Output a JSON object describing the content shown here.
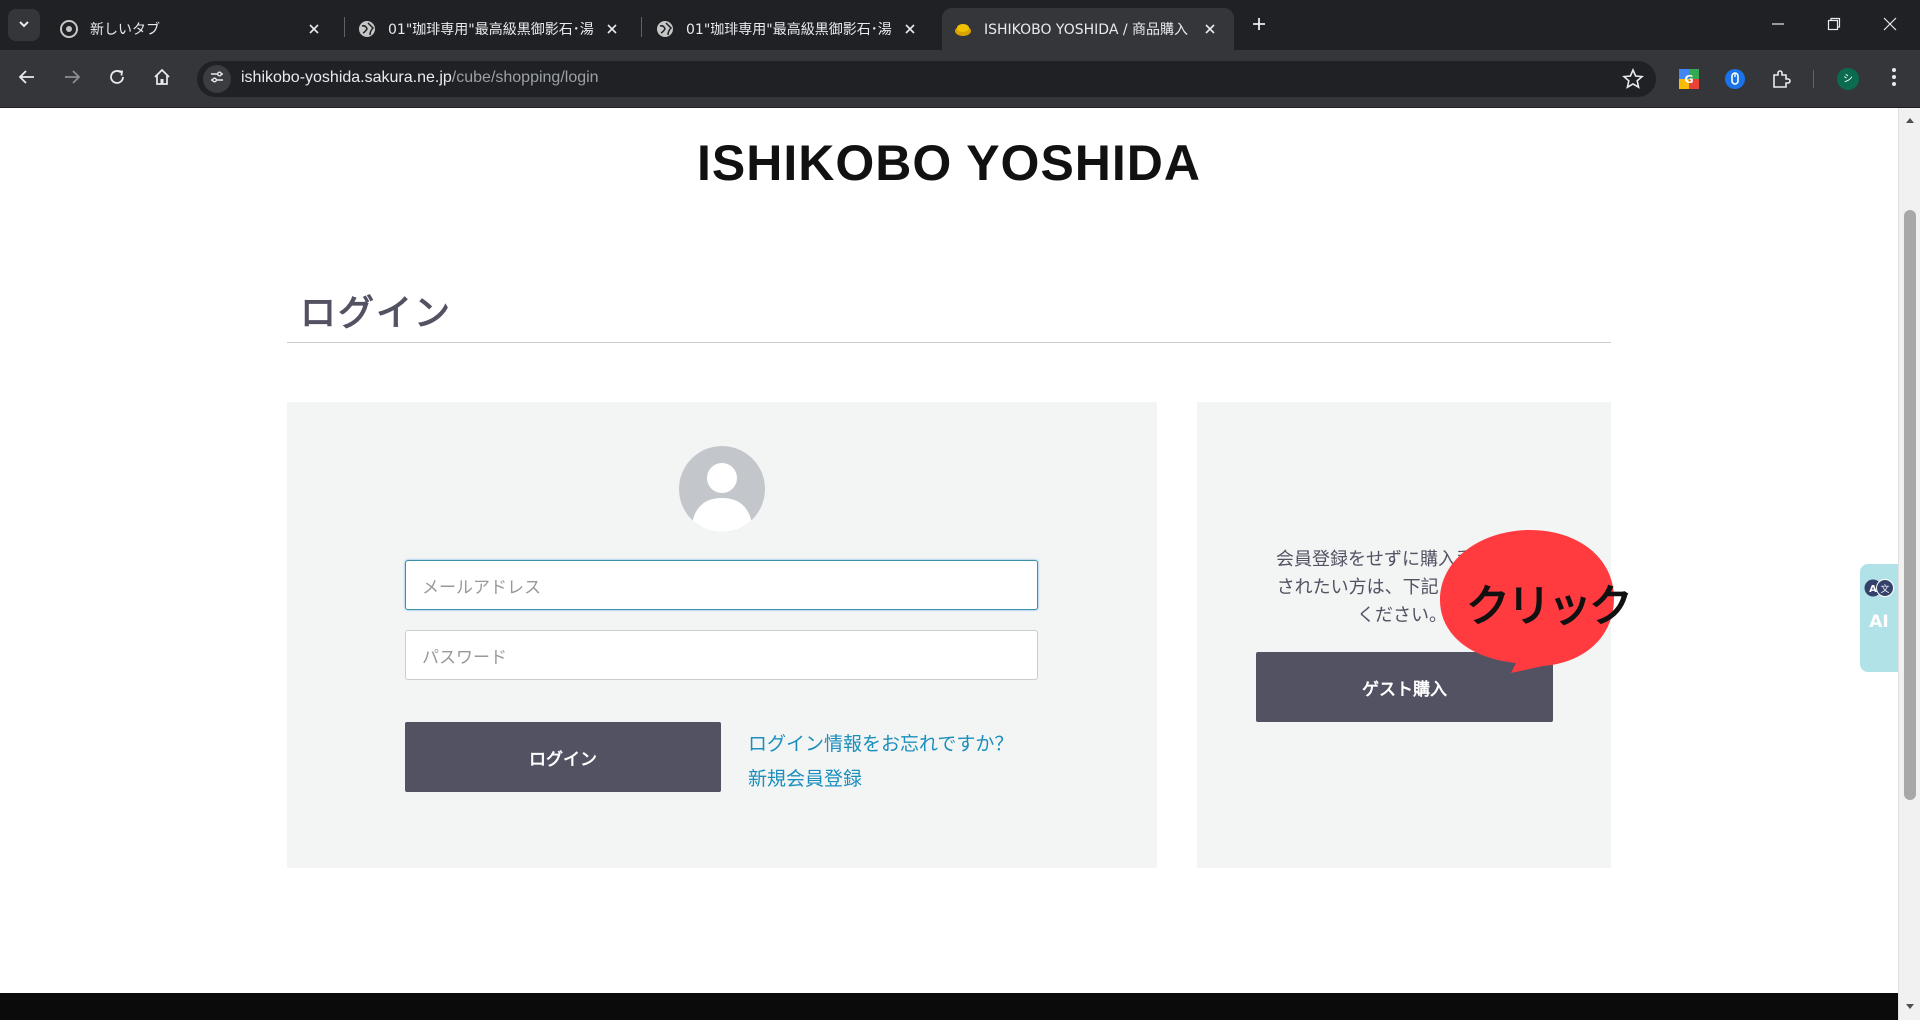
{
  "browser": {
    "tabs": [
      {
        "title": "新しいタブ",
        "icon": "chrome-icon",
        "active": false
      },
      {
        "title": "01\"珈琲専用\"最高級黒御影石･湯",
        "icon": "globe-icon",
        "active": false
      },
      {
        "title": "01\"珈琲専用\"最高級黒御影石･湯",
        "icon": "globe-icon",
        "active": false
      },
      {
        "title": "ISHIKOBO YOSHIDA / 商品購入",
        "icon": "stone-favicon",
        "active": true
      }
    ],
    "url_host": "ishikobo-yoshida.sakura.ne.jp",
    "url_path": "/cube/shopping/login",
    "profile_initial": "シ"
  },
  "page": {
    "brand": "ISHIKOBO YOSHIDA",
    "heading": "ログイン",
    "login": {
      "email_placeholder": "メールアドレス",
      "password_placeholder": "パスワード",
      "login_button": "ログイン",
      "forgot_link": "ログイン情報をお忘れですか？",
      "register_link": "新規会員登録"
    },
    "guest": {
      "text_line1": "会員登録をせずに購入手続きを",
      "text_line2": "されたい方は、下記より進んで",
      "text_line3": "ください。",
      "button": "ゲスト購入"
    },
    "annotation": {
      "text": "クリック",
      "color": "#ff3b3f"
    },
    "ai_widget": {
      "label": "AI",
      "icon": "translate-icon"
    }
  },
  "colors": {
    "accent": "#525263",
    "link": "#1a8fbd"
  }
}
